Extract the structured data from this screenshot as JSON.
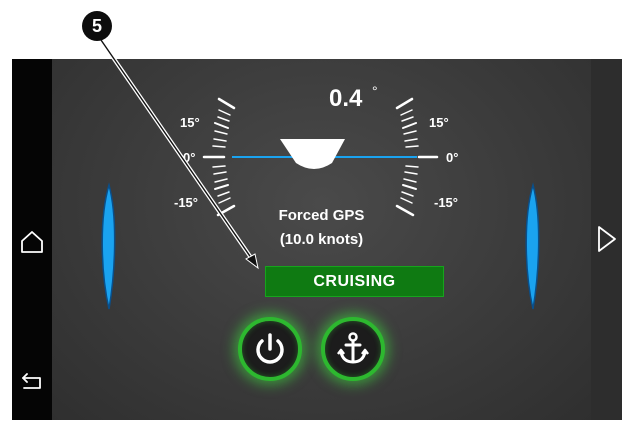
{
  "callout": {
    "number": "5"
  },
  "trim": {
    "value": "0.4",
    "unit": "°"
  },
  "gauge_left": {
    "top": "15°",
    "mid": "0°",
    "bottom": "-15°"
  },
  "gauge_right": {
    "top": "15°",
    "mid": "0°",
    "bottom": "-15°"
  },
  "mode": {
    "line1": "Forced GPS",
    "line2": "(10.0 knots)"
  },
  "status": {
    "label": "CRUISING"
  },
  "colors": {
    "accent_blue": "#1aa3f0",
    "status_green": "#0f7a12",
    "button_ring_green": "#2db82f",
    "background": "#3b3b3b"
  },
  "icons": {
    "home": "home-icon",
    "back": "back-arrow-icon",
    "next": "play-triangle-icon",
    "power": "power-icon",
    "anchor": "anchor-icon"
  }
}
